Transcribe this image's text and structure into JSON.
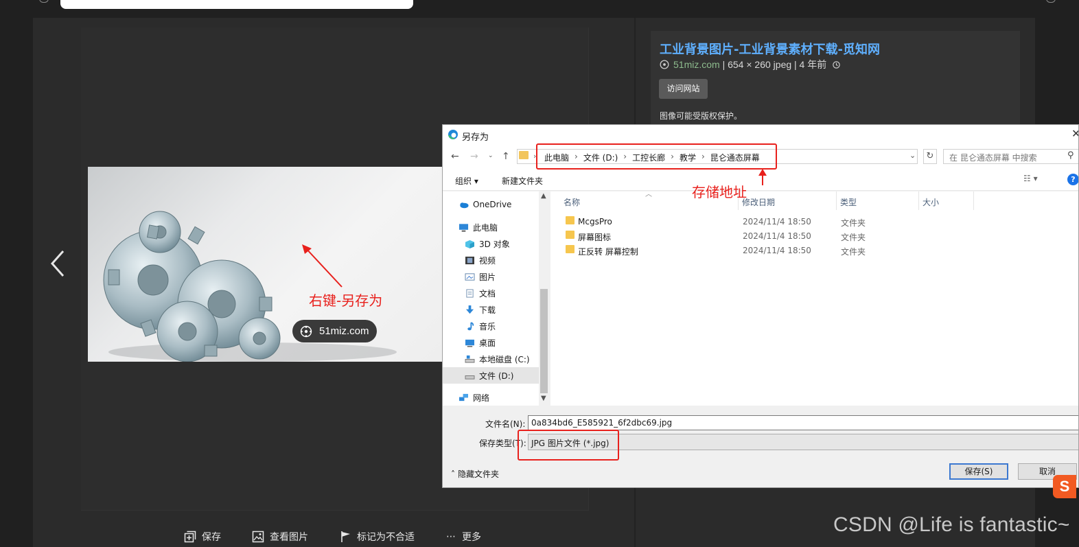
{
  "viewer": {
    "watermark_label": "51miz.com",
    "annotation_right_click": "右键-另存为",
    "annotation_save_path": "存储地址"
  },
  "info": {
    "title": "工业背景图片-工业背景素材下载-觅知网",
    "domain": "51miz.com",
    "meta": "|  654 × 260 jpeg  |  4 年前",
    "visit_button": "访问网站",
    "copyright": "图像可能受版权保护。"
  },
  "toolbar": {
    "save": "保存",
    "view_image": "查看图片",
    "flag": "标记为不合适",
    "more": "更多"
  },
  "dialog": {
    "title": "另存为",
    "breadcrumb": [
      "此电脑",
      "文件 (D:)",
      "工控长廊",
      "教学",
      "昆仑通态屏幕"
    ],
    "search_placeholder": "在 昆仑通态屏幕 中搜索",
    "organize": "组织 ▾",
    "new_folder": "新建文件夹",
    "help": "?",
    "nav": {
      "onedrive": "OneDrive",
      "this_pc": "此电脑",
      "objects3d": "3D 对象",
      "videos": "视频",
      "pictures": "图片",
      "documents": "文档",
      "downloads": "下载",
      "music": "音乐",
      "desktop": "桌面",
      "local_c": "本地磁盘 (C:)",
      "drive_d": "文件 (D:)",
      "network": "网络"
    },
    "columns": {
      "name": "名称",
      "modified": "修改日期",
      "type": "类型",
      "size": "大小"
    },
    "files": [
      {
        "name": "McgsPro",
        "modified": "2024/11/4 18:50",
        "type": "文件夹"
      },
      {
        "name": "屏幕图标",
        "modified": "2024/11/4 18:50",
        "type": "文件夹"
      },
      {
        "name": "正反转 屏幕控制",
        "modified": "2024/11/4 18:50",
        "type": "文件夹"
      }
    ],
    "filename_label": "文件名(N):",
    "filename_value": "0a834bd6_E585921_6f2dbc69.jpg",
    "filetype_label": "保存类型(T):",
    "filetype_value": "JPG 图片文件 (*.jpg)",
    "hide_folders": "隐藏文件夹",
    "save_button": "保存(S)",
    "cancel_button": "取消"
  },
  "csdn_watermark": "CSDN @Life is fantastic~",
  "colors": {
    "accent_red": "#e8201c",
    "link_blue": "#5fb0ff",
    "dialog_button_border": "#3b78d0"
  }
}
